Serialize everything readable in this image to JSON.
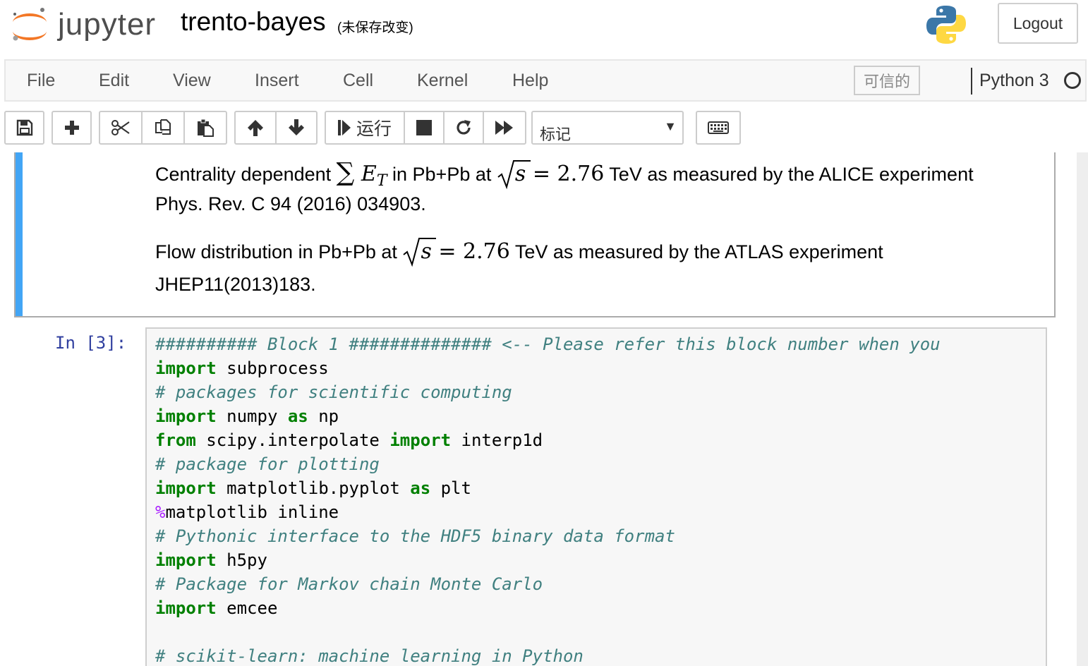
{
  "header": {
    "logo_text": "jupyter",
    "notebook_name": "trento-bayes",
    "save_status": "(未保存改变)",
    "logout_label": "Logout"
  },
  "menubar": {
    "items": [
      "File",
      "Edit",
      "View",
      "Insert",
      "Cell",
      "Kernel",
      "Help"
    ],
    "trusted_label": "可信的",
    "kernel_name": "Python 3"
  },
  "toolbar": {
    "run_label": "运行",
    "cell_type_selected": "标记",
    "icons": [
      "save-icon",
      "plus-icon",
      "cut-icon",
      "copy-icon",
      "paste-icon",
      "arrow-up-icon",
      "arrow-down-icon",
      "step-forward-icon",
      "stop-icon",
      "restart-icon",
      "fast-forward-icon",
      "keyboard-icon"
    ]
  },
  "markdown_cell": {
    "p1_a": "Centrality dependent ",
    "p1_sum": "∑",
    "p1_E": "E",
    "p1_T": "T",
    "p1_b": " in Pb+Pb at ",
    "p1_s": "s",
    "p1_eq": " = 2.76",
    "p1_c": " TeV as measured by the ALICE experiment",
    "p1_ref": "Phys. Rev. C 94 (2016) 034903.",
    "p2_a": "Flow distribution in Pb+Pb at ",
    "p2_s": "s",
    "p2_eq": " = 2.76",
    "p2_b": " TeV as measured by the ATLAS experiment",
    "p2_ref": "JHEP11(2013)183."
  },
  "code_cell": {
    "prompt": "In [3]:",
    "lines": [
      [
        {
          "t": "cm",
          "v": "########## Block 1 ############## <-- Please refer this block number when you"
        }
      ],
      [
        {
          "t": "kw",
          "v": "import"
        },
        {
          "t": "n",
          "v": " subprocess"
        }
      ],
      [
        {
          "t": "cm",
          "v": "# packages for scientific computing"
        }
      ],
      [
        {
          "t": "kw",
          "v": "import"
        },
        {
          "t": "n",
          "v": " numpy "
        },
        {
          "t": "kw",
          "v": "as"
        },
        {
          "t": "n",
          "v": " np"
        }
      ],
      [
        {
          "t": "kw",
          "v": "from"
        },
        {
          "t": "n",
          "v": " scipy.interpolate "
        },
        {
          "t": "kw",
          "v": "import"
        },
        {
          "t": "n",
          "v": " interp1d"
        }
      ],
      [
        {
          "t": "cm",
          "v": "# package for plotting"
        }
      ],
      [
        {
          "t": "kw",
          "v": "import"
        },
        {
          "t": "n",
          "v": " matplotlib.pyplot "
        },
        {
          "t": "kw",
          "v": "as"
        },
        {
          "t": "n",
          "v": " plt"
        }
      ],
      [
        {
          "t": "mg",
          "v": "%"
        },
        {
          "t": "n",
          "v": "matplotlib inline"
        }
      ],
      [
        {
          "t": "cm",
          "v": "# Pythonic interface to the HDF5 binary data format"
        }
      ],
      [
        {
          "t": "kw",
          "v": "import"
        },
        {
          "t": "n",
          "v": " h5py"
        }
      ],
      [
        {
          "t": "cm",
          "v": "# Package for Markov chain Monte Carlo"
        }
      ],
      [
        {
          "t": "kw",
          "v": "import"
        },
        {
          "t": "n",
          "v": " emcee"
        }
      ],
      [
        {
          "t": "n",
          "v": ""
        }
      ],
      [
        {
          "t": "cm",
          "v": "# scikit-learn: machine learning in Python"
        }
      ]
    ]
  }
}
